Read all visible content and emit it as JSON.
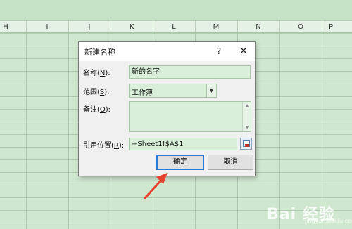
{
  "spreadsheet": {
    "columns": [
      "H",
      "I",
      "J",
      "K",
      "L",
      "M",
      "N",
      "O",
      "P"
    ]
  },
  "dialog": {
    "title": "新建名称",
    "help_glyph": "?",
    "close_glyph": "✕",
    "name_label_pre": "名称(",
    "name_label_key": "N",
    "name_label_post": "):",
    "name_value": "新的名字",
    "scope_label_pre": "范围(",
    "scope_label_key": "S",
    "scope_label_post": "):",
    "scope_value": "工作簿",
    "comment_label_pre": "备注(",
    "comment_label_key": "O",
    "comment_label_post": "):",
    "comment_value": "",
    "ref_label_pre": "引用位置(",
    "ref_label_key": "R",
    "ref_label_post": "):",
    "ref_value": "=Sheet1!$A$1",
    "ok_label": "确定",
    "cancel_label": "取消"
  },
  "watermark": {
    "text": "Bai 经验",
    "sub": "jingyan.baidu.com"
  },
  "colors": {
    "accent": "#2b7bd6",
    "arrow": "#e8432f",
    "grid_bg": "#cfe6cf"
  }
}
